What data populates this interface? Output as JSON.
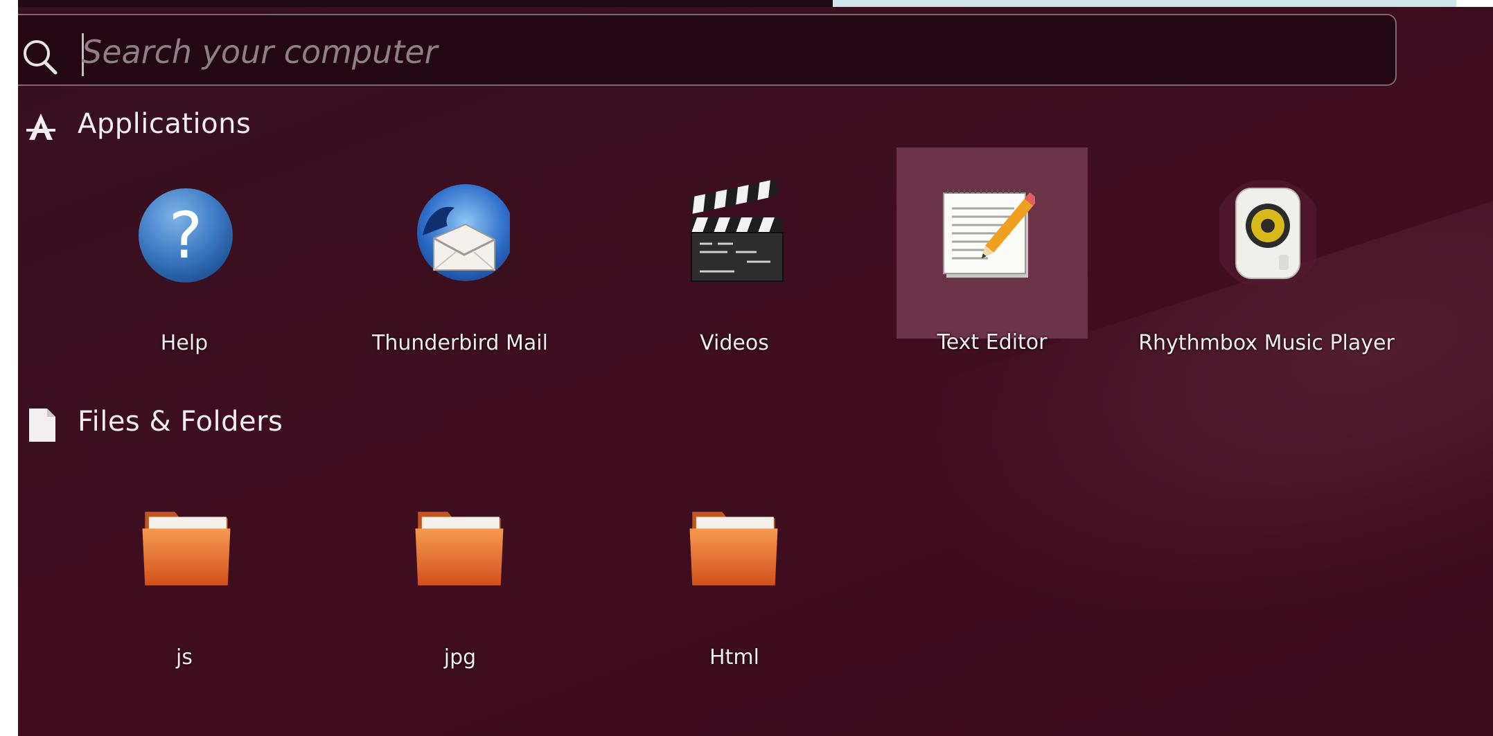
{
  "search": {
    "placeholder": "Search your computer",
    "icon": "search-icon"
  },
  "sections": {
    "applications": {
      "title": "Applications",
      "icon": "applications-icon",
      "items": [
        {
          "label": "Help",
          "icon": "help-icon"
        },
        {
          "label": "Thunderbird Mail",
          "icon": "thunderbird-icon"
        },
        {
          "label": "Videos",
          "icon": "clapperboard-icon"
        },
        {
          "label": "Text Editor",
          "icon": "text-editor-icon",
          "selected": true
        },
        {
          "label": "Rhythmbox Music Player",
          "icon": "speaker-icon"
        }
      ]
    },
    "files": {
      "title": "Files & Folders",
      "icon": "file-icon",
      "items": [
        {
          "label": "js",
          "icon": "folder-icon"
        },
        {
          "label": "jpg",
          "icon": "folder-icon"
        },
        {
          "label": "Html",
          "icon": "folder-icon"
        }
      ]
    }
  },
  "colors": {
    "dash_background": "#3f0e1f",
    "search_background": "#230712",
    "selected_tile": "#6a3348",
    "folder_orange": "#e8682a",
    "label_text": "#f0ecee"
  }
}
